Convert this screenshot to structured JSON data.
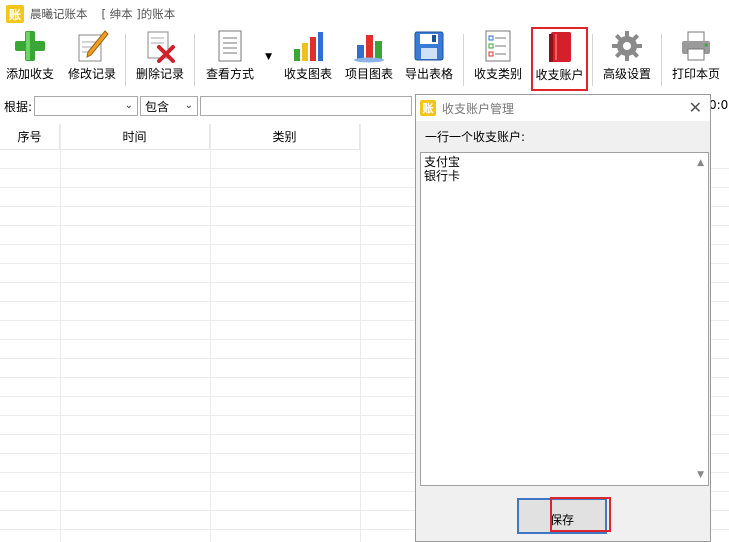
{
  "window": {
    "icon_char": "账",
    "title": "晨曦记账本",
    "book": "[ 绅本 ]的账本"
  },
  "toolbar": {
    "buttons": [
      {
        "label": "添加收支",
        "icon": "plus-icon"
      },
      {
        "label": "修改记录",
        "icon": "pencil-icon"
      },
      {
        "label": "删除记录",
        "icon": "delete-doc-icon"
      },
      {
        "label": "查看方式",
        "icon": "document-view-icon"
      },
      {
        "label": "收支图表",
        "icon": "bar-chart-icon"
      },
      {
        "label": "项目图表",
        "icon": "3d-chart-icon"
      },
      {
        "label": "导出表格",
        "icon": "export-sheet-icon"
      },
      {
        "label": "收支类别",
        "icon": "checklist-icon"
      },
      {
        "label": "收支账户",
        "icon": "red-book-icon"
      },
      {
        "label": "高级设置",
        "icon": "gear-icon"
      },
      {
        "label": "打印本页",
        "icon": "printer-icon"
      }
    ]
  },
  "filter": {
    "label": "根据:",
    "field_value": "",
    "match_value": "包含",
    "search_value": "",
    "time_fragment": "0:0"
  },
  "grid": {
    "columns": [
      "序号",
      "时间",
      "类别"
    ]
  },
  "dialog": {
    "icon_char": "账",
    "title": "收支账户管理",
    "close": "✕",
    "instruction": "一行一个收支账户:",
    "accounts": [
      "支付宝",
      "银行卡"
    ],
    "save_label": "保存"
  },
  "colors": {
    "highlight": "#e0242b",
    "app_icon": "#f5c518",
    "focus_border": "#3d78c4"
  }
}
